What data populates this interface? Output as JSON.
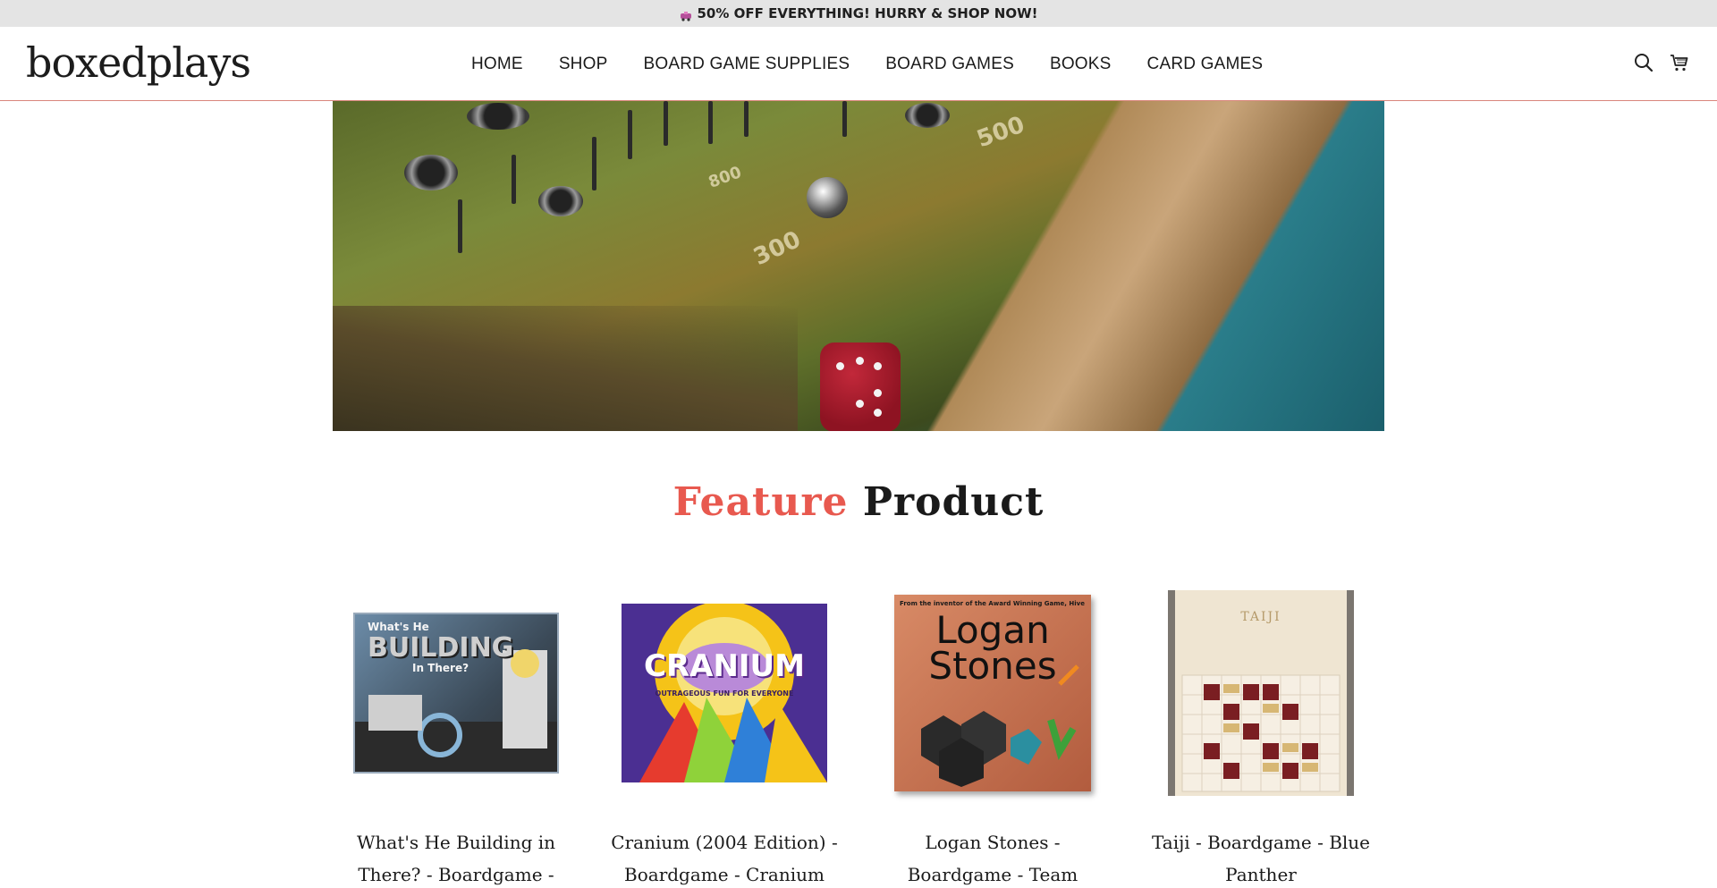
{
  "announcement": {
    "text": "50% OFF EVERYTHING! HURRY & SHOP NOW!",
    "icon": "gift-car-icon"
  },
  "header": {
    "logo": "boxedplays",
    "nav": [
      "HOME",
      "SHOP",
      "BOARD GAME SUPPLIES",
      "BOARD GAMES",
      "BOOKS",
      "CARD GAMES"
    ],
    "icons": [
      "search-icon",
      "cart-icon"
    ]
  },
  "hero": {
    "board_numbers": [
      "300",
      "500",
      "800"
    ]
  },
  "featured": {
    "title_accent": "Feature",
    "title_rest": "Product",
    "products": [
      {
        "name": "What's He Building in There? - Boardgame - Baksha Games",
        "box_text": [
          "What's He",
          "BUILDING",
          "In There?"
        ]
      },
      {
        "name": "Cranium (2004 Edition) - Boardgame - Cranium",
        "box_text": [
          "CRANIUM",
          "OUTRAGEOUS FUN FOR EVERYONE"
        ]
      },
      {
        "name": "Logan Stones - Boardgame - Team Components",
        "box_text": [
          "From the inventor of the Award Winning Game, Hive",
          "Logan",
          "Stones"
        ]
      },
      {
        "name": "Taiji - Boardgame - Blue Panther",
        "box_text": [
          "TAIJI"
        ]
      }
    ]
  },
  "colors": {
    "accent": "#e8594f",
    "announce_bg": "#e4e4e4",
    "header_border": "#d9867c"
  }
}
